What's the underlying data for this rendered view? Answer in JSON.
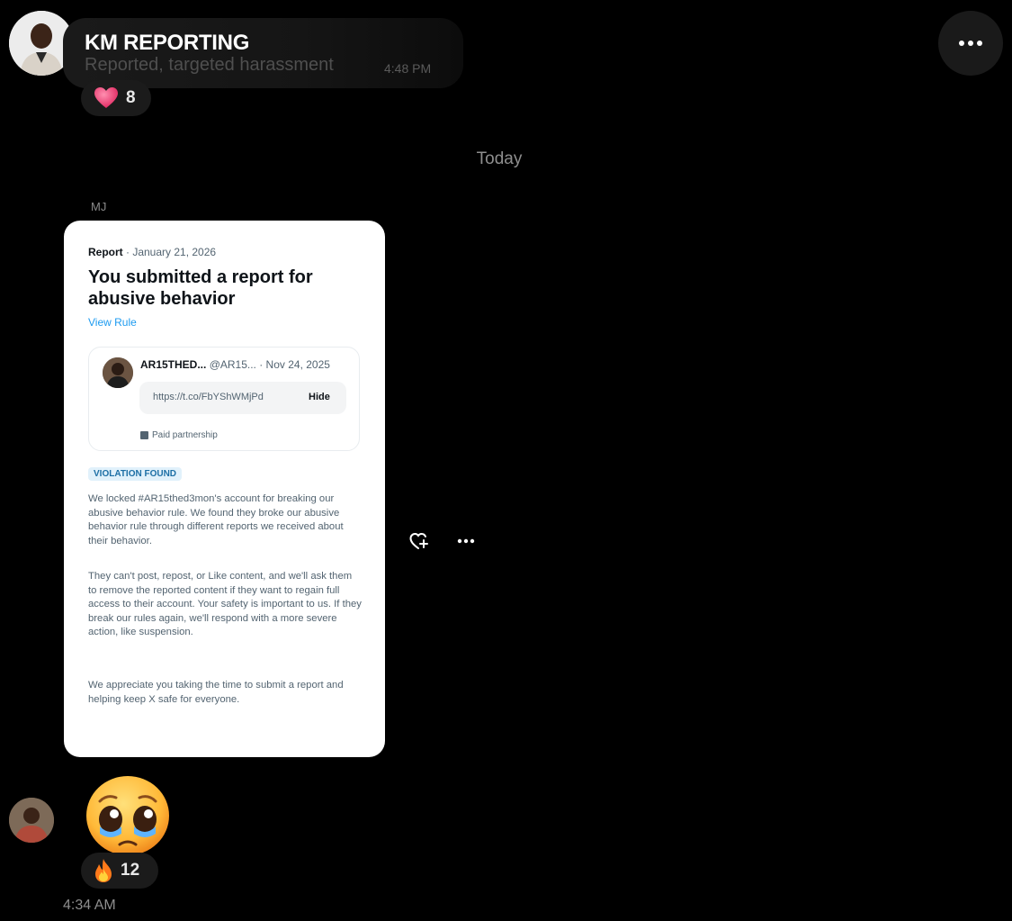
{
  "header": {
    "title": "KM REPORTING",
    "reply_snippet": "Reported, targeted harassment",
    "reply_time": "4:48 PM",
    "reaction_count": "8",
    "avatar_icon": "user-avatar-icon",
    "more_icon": "more-horizontal-icon"
  },
  "divider": {
    "today_label": "Today"
  },
  "message": {
    "sender_initials": "MJ",
    "card": {
      "meta_type": "Report",
      "meta_date": " · January 21, 2026",
      "title": "You submitted a report for abusive behavior",
      "view_rule": "View Rule",
      "quote": {
        "name": "AR15THED...",
        "handle_date": " @AR15... · Nov 24, 2025",
        "link_url": "https://t.co/FbYShWMjPd",
        "hide_label": "Hide",
        "paid_label": "Paid partnership"
      },
      "violation_label": "VIOLATION FOUND",
      "paragraph_1": "We locked #AR15thed3mon's account for breaking our abusive behavior rule. We found they broke our abusive behavior rule through different reports we received about their behavior.",
      "paragraph_2": "They can't post, repost, or Like content, and we'll ask them to remove the reported content if they want to regain full access to their account. Your safety is important to us. If they break our rules again, we'll respond with a more severe action, like suspension.",
      "paragraph_3": "We appreciate you taking the time to submit a report and helping keep X safe for everyone."
    }
  },
  "reply_message": {
    "emoji": "pleading-face-with-tears",
    "reaction_count": "12",
    "reaction_icon": "fire-icon",
    "time": "4:34 AM"
  },
  "colors": {
    "background": "#000000",
    "bubble": "#1a1a1a",
    "link_blue": "#1d9bf0",
    "heart_pink": "#f0446f"
  }
}
